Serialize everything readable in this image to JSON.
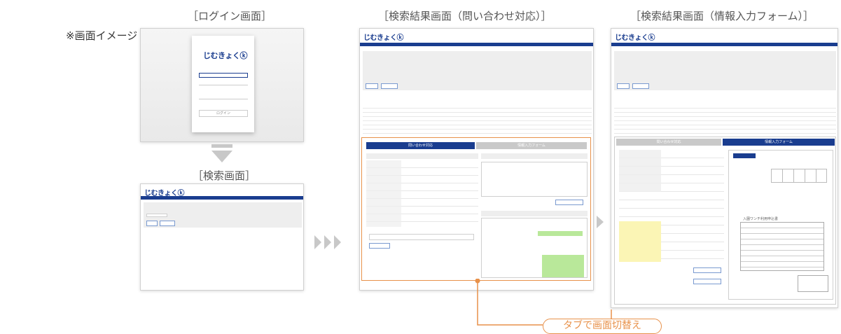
{
  "note": "※画面イメージ",
  "labels": {
    "login": "［ログイン画面］",
    "search": "［検索画面］",
    "result_inquiry": "［検索結果画面（問い合わせ対応）］",
    "result_form": "［検索結果画面（情報入力フォーム）］"
  },
  "tab_switch": "タブで画面切替え",
  "logo_text": "じむきょくⓚ",
  "login_screen": {
    "button": "ログイン"
  },
  "inquiry_tabs": [
    "問い合わせ対応",
    "情報入力フォーム"
  ],
  "form_tabs": [
    "問い合わせ対応",
    "情報入力フォーム"
  ],
  "form_doc_title": "入園ワンチ利用申込書",
  "colors": {
    "brand": "#1a3d8f",
    "accent": "#e8914a",
    "highlight": "#fbf5b5",
    "bubble": "#b9e89a"
  }
}
